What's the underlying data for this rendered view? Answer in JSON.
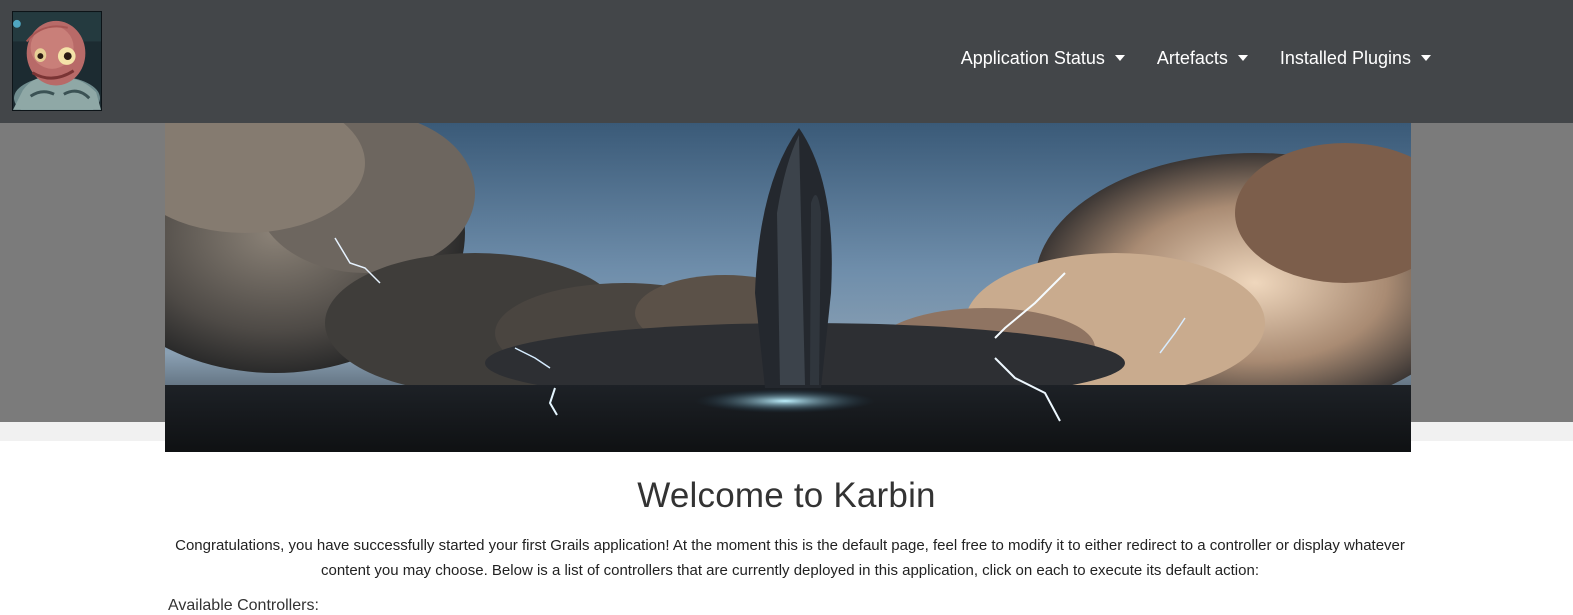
{
  "nav": {
    "logo_icon": "alien-avatar-logo",
    "items": [
      {
        "label": "Application Status"
      },
      {
        "label": "Artefacts"
      },
      {
        "label": "Installed Plugins"
      }
    ]
  },
  "hero": {
    "image": "storm-clouds-tower-banner"
  },
  "content": {
    "title": "Welcome to Karbin",
    "intro": "Congratulations, you have successfully started your first Grails application! At the moment this is the default page, feel free to modify it to either redirect to a controller or display whatever content you may choose. Below is a list of controllers that are currently deployed in this application, click on each to execute its default action:",
    "controllers_heading": "Available Controllers:"
  },
  "colors": {
    "navbar": "#434649",
    "hero_band": "#7b7b7b",
    "nav_text": "#ffffff"
  }
}
